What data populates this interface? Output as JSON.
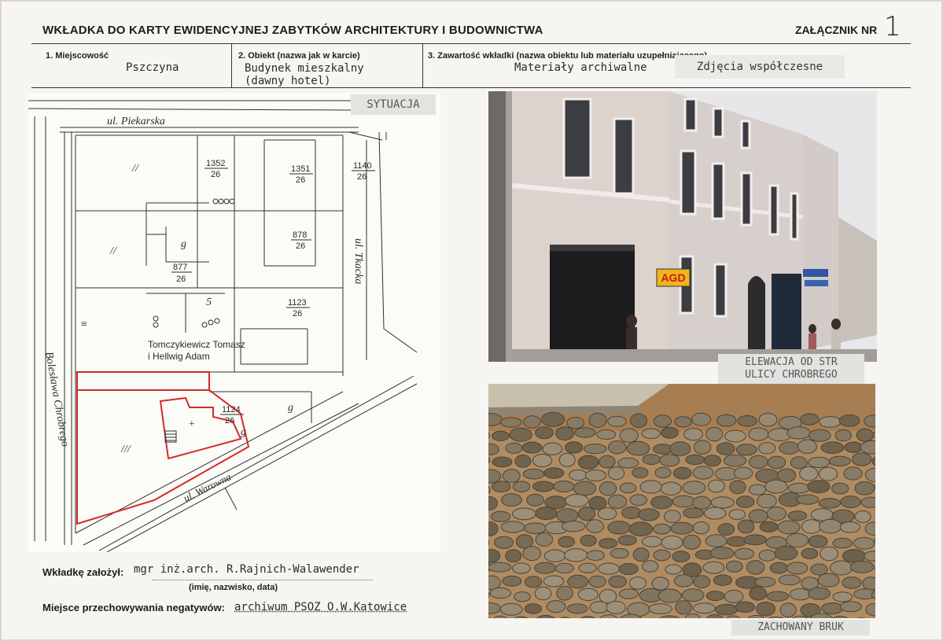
{
  "header": {
    "title": "WKŁADKA DO KARTY EWIDENCYJNEJ ZABYTKÓW ARCHITEKTURY I BUDOWNICTWA",
    "attachment_label": "ZAŁĄCZNIK NR",
    "attachment_number": "1"
  },
  "fields": {
    "place_label": "1. Miejscowość",
    "place_value": "Pszczyna",
    "object_label": "2. Obiekt (nazwa jak w karcie)",
    "object_value_line1": "Budynek mieszkalny",
    "object_value_line2": "(dawny hotel)",
    "content_label": "3. Zawartość wkładki (nazwa obiektu lub materiału uzupełniającego)",
    "content_value": "Materiały archiwalne",
    "content_value_stamp": "Zdjęcia współczesne"
  },
  "map": {
    "stamp": "SYTUACJA",
    "street_piekarska": "ul. Piekarska",
    "street_tkacka": "ul. Tkacka",
    "street_chrobrego": "Bolesława Chrobrego",
    "street_warowna": "ul. Warowna",
    "owner_line1": "Tomczykiewicz Tomasz",
    "owner_line2": "i Hellwig Adam",
    "parcels": [
      {
        "top": "1352",
        "bottom": "26"
      },
      {
        "top": "1351",
        "bottom": "26"
      },
      {
        "top": "1140",
        "bottom": "26"
      },
      {
        "top": "878",
        "bottom": "26"
      },
      {
        "top": "877",
        "bottom": "26"
      },
      {
        "top": "1123",
        "bottom": "26"
      },
      {
        "top": "1124",
        "bottom": "26"
      }
    ]
  },
  "photos": {
    "facade_caption_line1": "ELEWACJA OD STR",
    "facade_caption_line2": "ULICY CHROBREGO",
    "facade_sign": "AGD",
    "cobble_caption": "ZACHOWANY BRUK"
  },
  "footer": {
    "author_label": "Wkładkę założył:",
    "author_value": "mgr inż.arch. R.Rajnich-Walawender",
    "author_hint": "(imię, nazwisko, data)",
    "negatives_label": "Miejsce przechowywania negatywów:",
    "negatives_value": "archiwum PSOZ O.W.Katowice"
  },
  "colors": {
    "parcel_outline": "#d42a2a",
    "ink": "#2a2a2a",
    "facade": "#ddd6d2",
    "cobble": "#8a7a62"
  }
}
